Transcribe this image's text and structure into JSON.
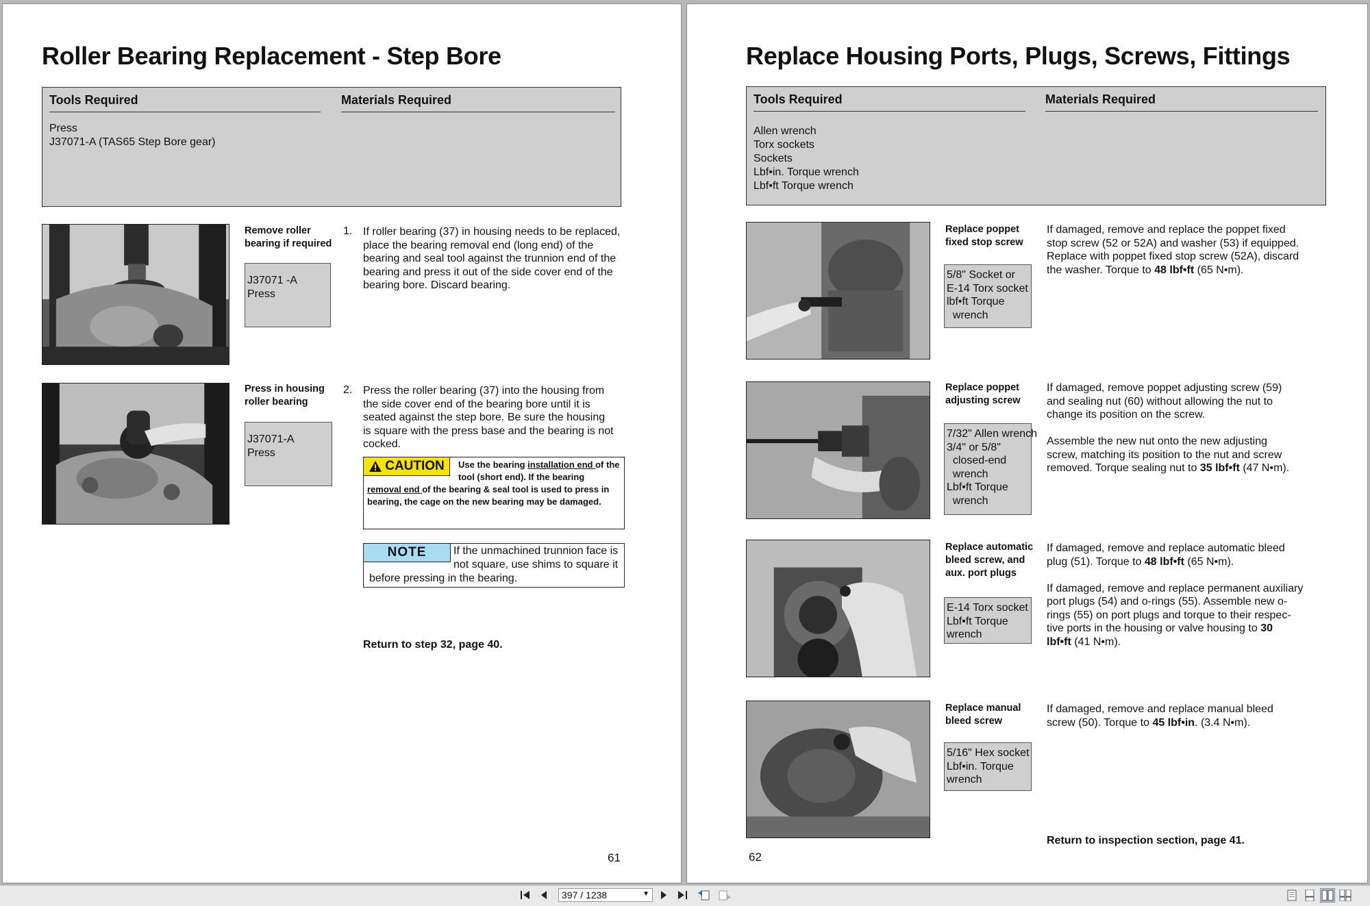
{
  "left_page": {
    "title": "Roller Bearing Replacement - Step Bore",
    "tools_header": "Tools Required",
    "materials_header": "Materials Required",
    "tools": [
      "Press",
      "J37071-A (TAS65 Step Bore gear)"
    ],
    "steps": [
      {
        "caption": [
          "Remove roller",
          "bearing if required"
        ],
        "tools": [
          "J37071 -A",
          "Press"
        ],
        "number": "1.",
        "text": [
          "If roller bearing (37) in housing needs to be replaced,",
          "place the bearing removal end (long end) of the",
          "bearing and seal tool against the trunnion end of the",
          "bearing and press it out of the side cover end of the",
          "bearing bore. Discard bearing."
        ]
      },
      {
        "caption": [
          "Press in housing",
          "roller bearing"
        ],
        "tools": [
          "J37071-A",
          "Press"
        ],
        "number": "2.",
        "text": [
          "Press the roller bearing (37) into the housing from",
          "the side cover end of the bearing bore until it is",
          "seated against the step bore. Be sure the housing",
          "is square with the press base and the bearing is not",
          "cocked."
        ]
      }
    ],
    "caution": {
      "label": "CAUTION",
      "t1": "Use the bearing ",
      "u1": "installation end ",
      "t2": "of the tool (short end). If the bearing ",
      "u2": "removal end ",
      "t3": "of the bearing & seal tool is used to press in bearing, the cage on the new bearing may be damaged."
    },
    "note": {
      "label": "NOTE",
      "text": "If the unmachined trunnion face is not square, use shims to square it before pressing in the bearing."
    },
    "return_text": "Return to step 32, page 40.",
    "page_number": "61"
  },
  "right_page": {
    "title": "Replace Housing Ports, Plugs, Screws, Fittings",
    "tools_header": "Tools Required",
    "materials_header": "Materials Required",
    "tools": [
      "Allen wrench",
      "Torx sockets",
      "Sockets",
      "Lbf•in. Torque wrench",
      "Lbf•ft Torque wrench"
    ],
    "steps": [
      {
        "caption": [
          "Replace poppet",
          "fixed stop screw"
        ],
        "tools": [
          "5/8\" Socket or",
          "E-14 Torx socket",
          "lbf•ft Torque",
          "  wrench"
        ],
        "text": [
          [
            {
              "t": "If damaged, remove and replace the poppet fixed"
            }
          ],
          [
            {
              "t": "stop screw (52 or 52A) and washer (53) if equipped."
            }
          ],
          [
            {
              "t": "Replace with poppet fixed stop screw (52A), discard"
            }
          ],
          [
            {
              "t": "the washer. Torque to "
            },
            {
              "t": "48 lbf•ft",
              "b": true
            },
            {
              "t": " (65 N•m)."
            }
          ]
        ]
      },
      {
        "caption": [
          "Replace poppet",
          "adjusting screw"
        ],
        "tools": [
          "7/32\" Allen wrench",
          "3/4\" or 5/8\"",
          "  closed-end",
          "  wrench",
          "Lbf•ft Torque",
          "  wrench"
        ],
        "text": [
          [
            {
              "t": "If damaged, remove poppet adjusting screw (59)"
            }
          ],
          [
            {
              "t": "and sealing nut (60) without allowing the nut to"
            }
          ],
          [
            {
              "t": "change its position on the screw."
            }
          ],
          [
            {
              "t": " "
            }
          ],
          [
            {
              "t": "Assemble the new nut onto the new adjusting"
            }
          ],
          [
            {
              "t": "screw, matching its position to the nut and screw"
            }
          ],
          [
            {
              "t": "removed. Torque sealing nut to "
            },
            {
              "t": "35 lbf•ft",
              "b": true
            },
            {
              "t": " (47 N•m)."
            }
          ]
        ]
      },
      {
        "caption": [
          "Replace automatic",
          "bleed screw, and",
          "aux. port plugs"
        ],
        "tools": [
          "E-14 Torx socket",
          "Lbf•ft Torque",
          "wrench"
        ],
        "text": [
          [
            {
              "t": "If damaged, remove and replace automatic bleed"
            }
          ],
          [
            {
              "t": "plug (51). Torque to "
            },
            {
              "t": "48 lbf•ft",
              "b": true
            },
            {
              "t": " (65 N•m)."
            }
          ],
          [
            {
              "t": " "
            }
          ],
          [
            {
              "t": "If damaged, remove and replace permanent auxiliary"
            }
          ],
          [
            {
              "t": "port plugs (54) and o-rings (55). Assemble new o-"
            }
          ],
          [
            {
              "t": "rings (55) on port plugs and torque to their respec-"
            }
          ],
          [
            {
              "t": "tive ports in the housing or valve housing to "
            },
            {
              "t": "30",
              "b": true
            }
          ],
          [
            {
              "t": "lbf•ft",
              "b": true
            },
            {
              "t": " (41 N•m)."
            }
          ]
        ]
      },
      {
        "caption": [
          "Replace manual",
          "bleed screw"
        ],
        "tools": [
          "5/16\" Hex socket",
          "Lbf•in. Torque",
          "wrench"
        ],
        "text": [
          [
            {
              "t": "If damaged, remove and replace manual bleed"
            }
          ],
          [
            {
              "t": "screw (50). Torque to "
            },
            {
              "t": "45 lbf•in",
              "b": true
            },
            {
              "t": ". (3.4 N•m)."
            }
          ]
        ]
      }
    ],
    "return_text": "Return to inspection section, page 41.",
    "page_number": "62"
  },
  "toolbar": {
    "page_indicator": "397 / 1238",
    "icons": [
      "first-page-icon",
      "previous-page-icon",
      "next-page-icon",
      "last-page-icon",
      "go-back-icon",
      "go-forward-icon",
      "single-page-view-icon",
      "continuous-view-icon",
      "facing-view-icon",
      "continuous-facing-view-icon"
    ]
  }
}
